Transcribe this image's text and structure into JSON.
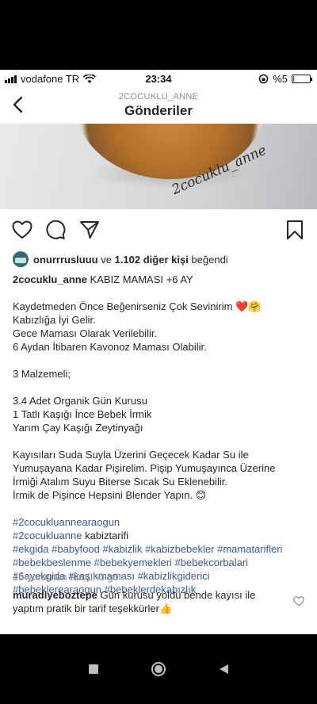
{
  "status_bar": {
    "carrier": "vodafone TR",
    "time": "23:34",
    "battery_percent": "%5",
    "battery_level": 0.05,
    "battery_color": "#e0241c"
  },
  "header": {
    "username_caps": "2COCUKLU_ANNE",
    "title": "Gönderiler"
  },
  "post": {
    "watermark": "2cocuklu_anne",
    "likes": {
      "user": "onurrrusluuu",
      "and": " ve ",
      "count": "1.102 diğer kişi",
      "suffix": " beğendi"
    },
    "caption_user": "2cocuklu_anne",
    "caption_title": " KABIZ MAMASI +6 AY",
    "lines": [
      "",
      "Kaydetmeden Önce Beğenirseniz Çok Sevinirim ❤️🤗",
      "Kabızlığa İyi Gelir.",
      "Gece Maması Olarak Verilebilir.",
      "6 Aydan İtibaren Kavonoz Maması Olabilir.",
      "",
      "3 Malzemeli;",
      "",
      "3.4 Adet Organik Gün Kurusu",
      "1 Tatlı Kaşığı İnce Bebek İrmik",
      "Yarım Çay Kaşığı Zeytinyağı",
      "",
      "Kayısıları Suda Suyla Üzerini Geçecek Kadar Su ile",
      "Yumuşayana Kadar Pişirelim. Pişip Yumuşayınca Üzerine",
      "İrmiği Atalım Suyu Biterse Sıcak Su Eklenebilir.",
      "İrmik de Pişince Hepsini Blender Yapın. 😊"
    ],
    "hashtag_lines": [
      [
        "#2cocukluannearaogun"
      ],
      [
        "#2cocukluanne",
        "kabiztarifi"
      ],
      [
        "#ekgida",
        "#babyfood",
        "#kabizlik",
        "#kabizbebekler",
        "#mamatarifleri"
      ],
      [
        "#bebekbeslenme",
        "#bebekyemekleri",
        "#bebekcorbalari"
      ],
      [
        "#6ayekgida",
        "#kaşıkmaması",
        "#kabizlikgiderici"
      ],
      [
        "#bebeklerearaogun",
        "#bebeklerdekabızlık"
      ]
    ],
    "view_comments": "15 yorumun tümünü gör",
    "comment": {
      "user": "muradiyeboztepe",
      "text": " Gün kurusu yoldu bende kayısı ile yaptım pratik bir tarif teşekkürler👍"
    }
  },
  "icons": {
    "back": "chevron-left-icon",
    "like": "heart-icon",
    "comment": "comment-icon",
    "share": "send-icon",
    "save": "bookmark-icon",
    "nav_recent": "square-icon",
    "nav_home": "circle-icon",
    "nav_back": "triangle-back-icon"
  }
}
